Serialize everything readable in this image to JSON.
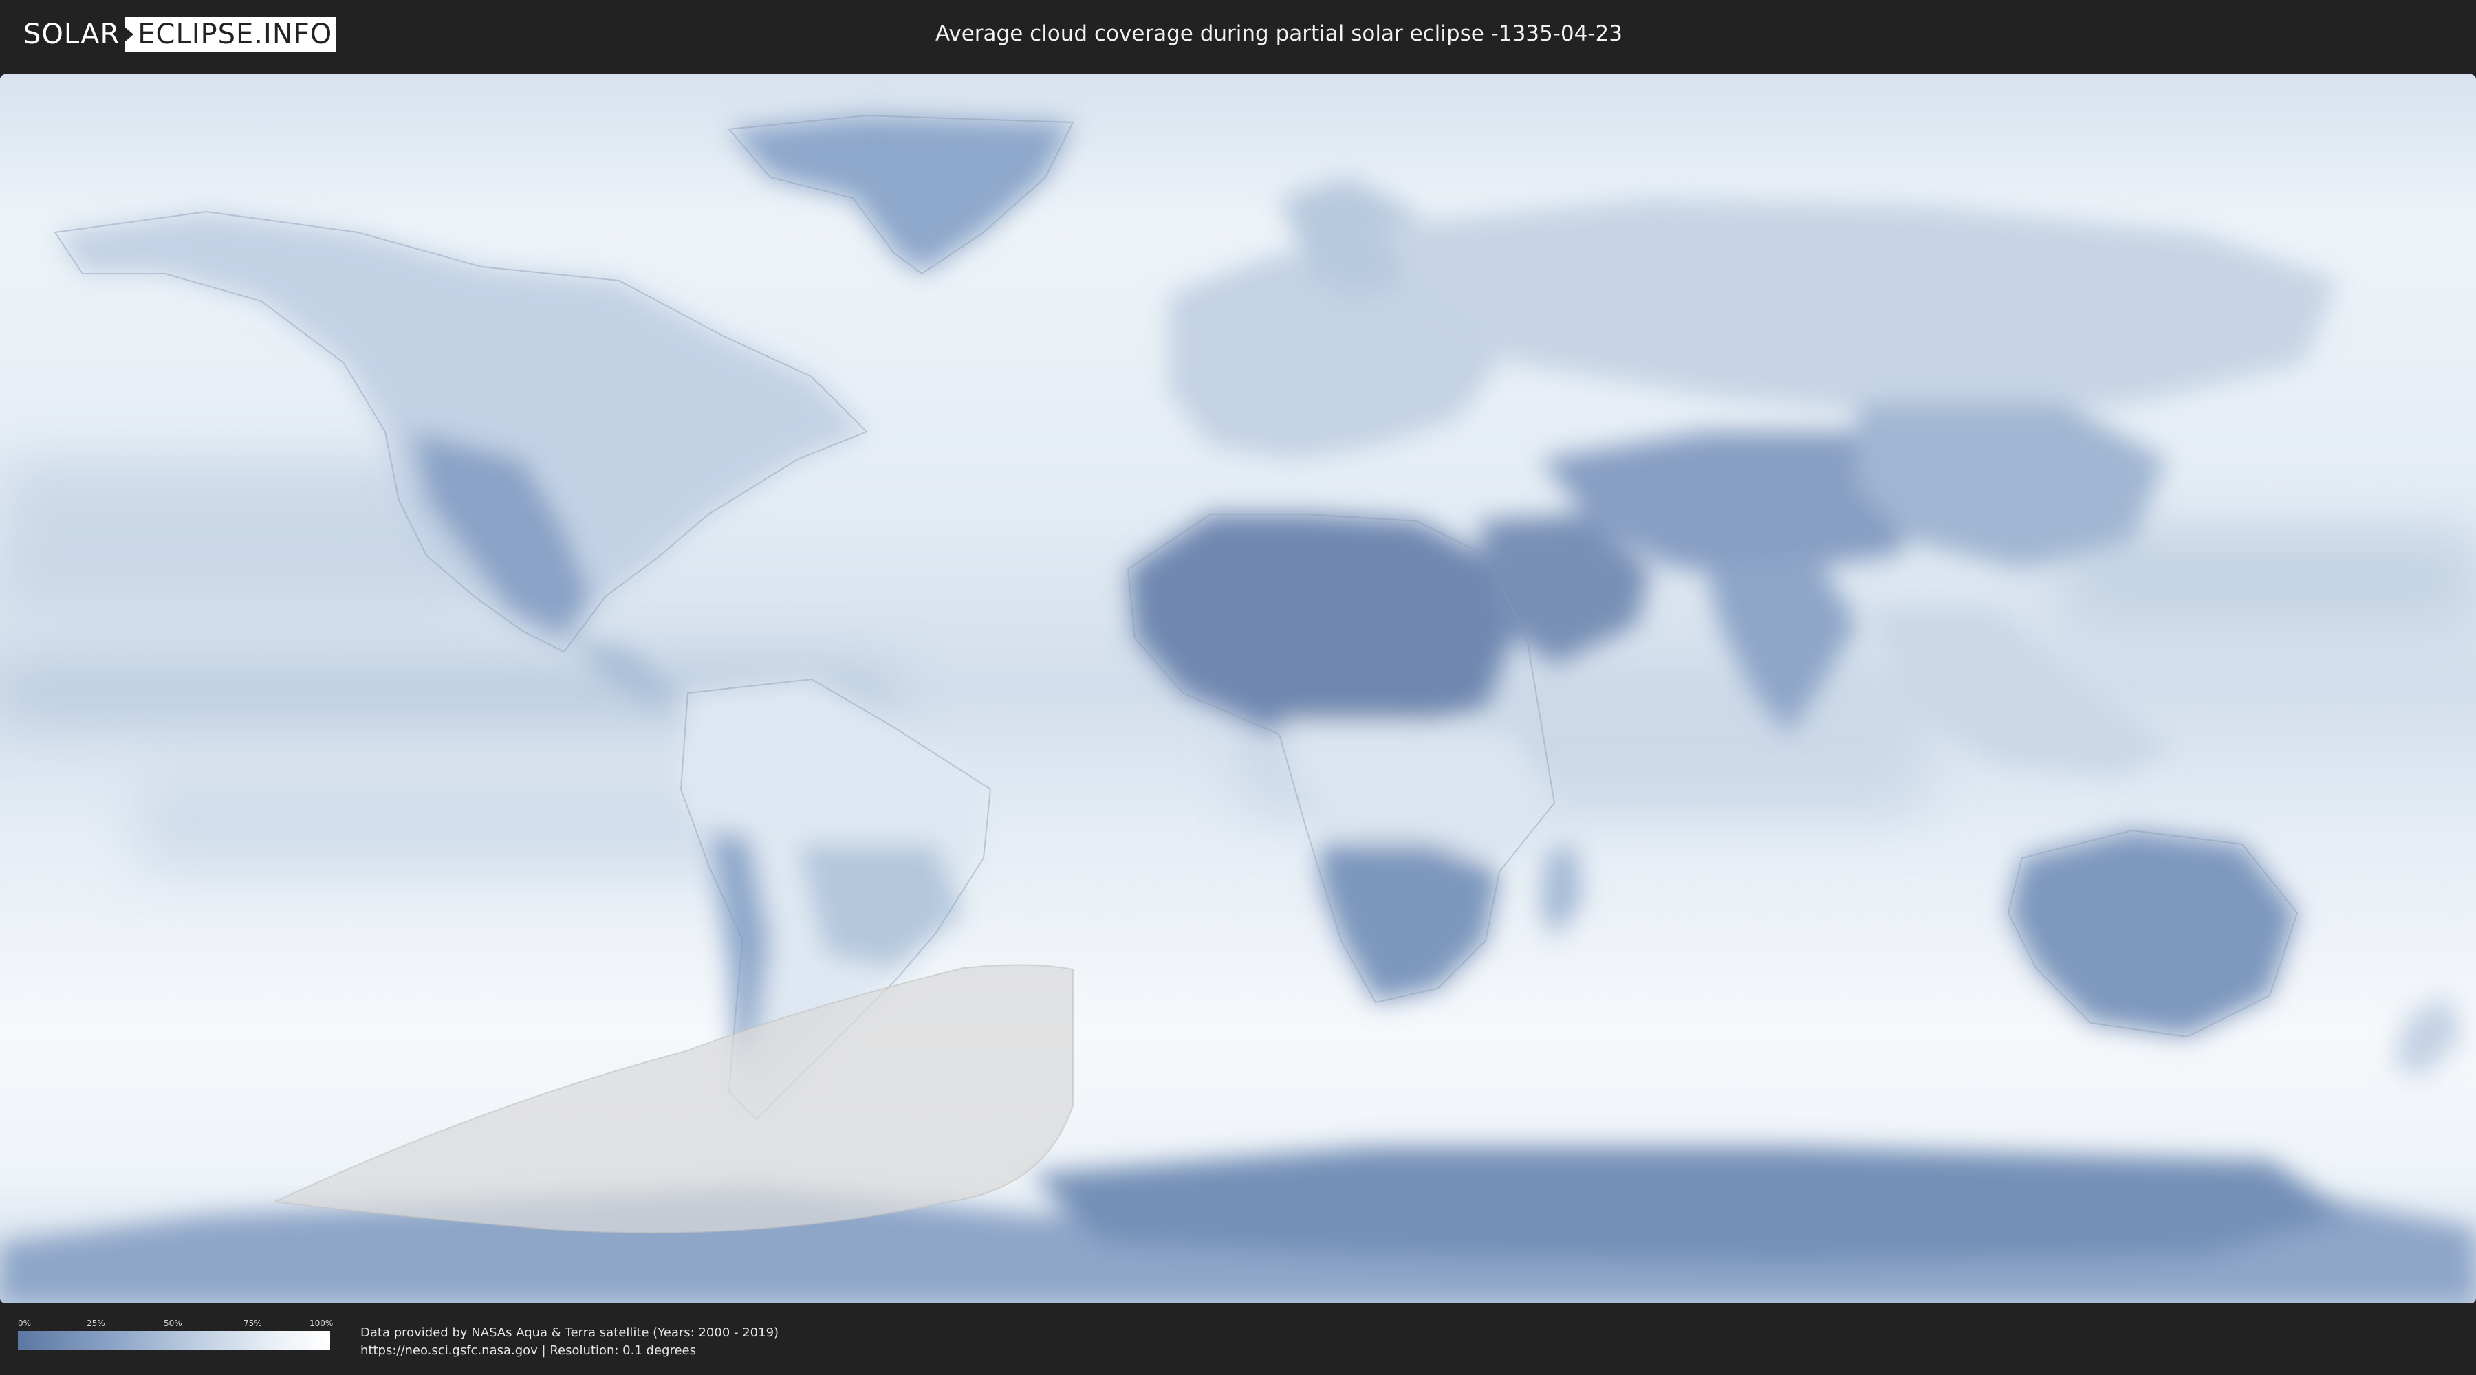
{
  "header": {
    "logo_left": "SOLAR",
    "logo_right": "ECLIPSE.INFO",
    "title": "Average cloud coverage during partial solar eclipse -1335-04-23"
  },
  "colors": {
    "background": "#222222",
    "clear_sky": "#5c77a3",
    "full_cloud": "#ffffff",
    "eclipse_shade": "#d9d9d9"
  },
  "map": {
    "kind": "world-cloud-coverage",
    "projection": "equirectangular",
    "eclipse_region": "partial eclipse visibility zone over southern Pacific / Antarctica"
  },
  "legend": {
    "ticks": [
      "0%",
      "25%",
      "50%",
      "75%",
      "100%"
    ]
  },
  "credits": {
    "line1": "Data provided by NASAs Aqua & Terra satellite (Years: 2000 - 2019)",
    "line2": "https://neo.sci.gsfc.nasa.gov | Resolution: 0.1 degrees"
  }
}
